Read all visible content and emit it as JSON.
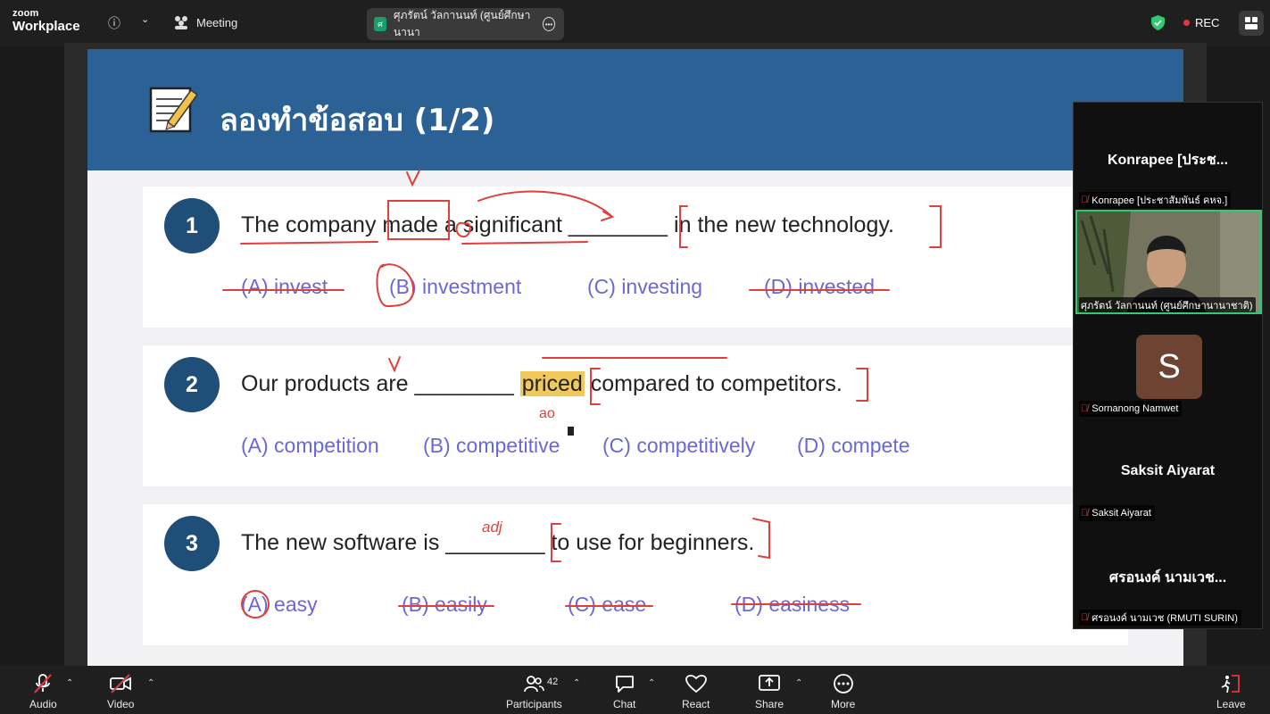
{
  "app": {
    "brand_small": "zoom",
    "brand_large": "Workplace",
    "meeting_label": "Meeting",
    "speaker_pill": "ศุภรัตน์ วัลกานนท์ (ศูนย์ศึกษานานา",
    "speaker_initial": "ศ",
    "rec_label": "REC"
  },
  "slide": {
    "title": "ลองทำข้อสอบ (1/2)",
    "questions": [
      {
        "num": "1",
        "text": "The company made a significant ________ in the new technology.",
        "options": [
          "(A) invest",
          "(B) investment",
          "(C) investing",
          "(D) invested"
        ]
      },
      {
        "num": "2",
        "text_before": "Our products are ________ ",
        "text_highlight": "priced",
        "text_after": " compared to competitors.",
        "options": [
          "(A) competition",
          "(B) competitive",
          "(C) competitively",
          "(D) compete"
        ]
      },
      {
        "num": "3",
        "text": "The new software is ________ to use for beginners.",
        "options": [
          "(A) easy",
          "(B) easily",
          "(C) ease",
          "(D) easiness"
        ]
      }
    ],
    "annotations": {
      "q2_note": "ao",
      "q3_note": "adj"
    }
  },
  "participants": [
    {
      "big_name": "Konrapee [ประช...",
      "label": "Konrapee [ประชาสัมพันธ์ คหจ.]"
    },
    {
      "big_name": "",
      "label": "ศุภรัตน์ วัลกานนท์ (ศูนย์ศึกษานานาชาติ)"
    },
    {
      "big_name": "",
      "avatar": "S",
      "label": "Sornanong Namwet"
    },
    {
      "big_name": "Saksit Aiyarat",
      "label": "Saksit Aiyarat"
    },
    {
      "big_name": "ศรอนงค์ นามเวช...",
      "label": "ศรอนงค์ นามเวช (RMUTI SURIN)"
    }
  ],
  "toolbar": {
    "audio": "Audio",
    "video": "Video",
    "participants": "Participants",
    "participants_count": "42",
    "chat": "Chat",
    "react": "React",
    "share": "Share",
    "more": "More",
    "leave": "Leave"
  },
  "colors": {
    "slide_header": "#2b6194",
    "option_text": "#6b68d6",
    "ink": "#e0403a",
    "highlight": "#f1c85a",
    "active_speaker": "#2ecc71"
  }
}
